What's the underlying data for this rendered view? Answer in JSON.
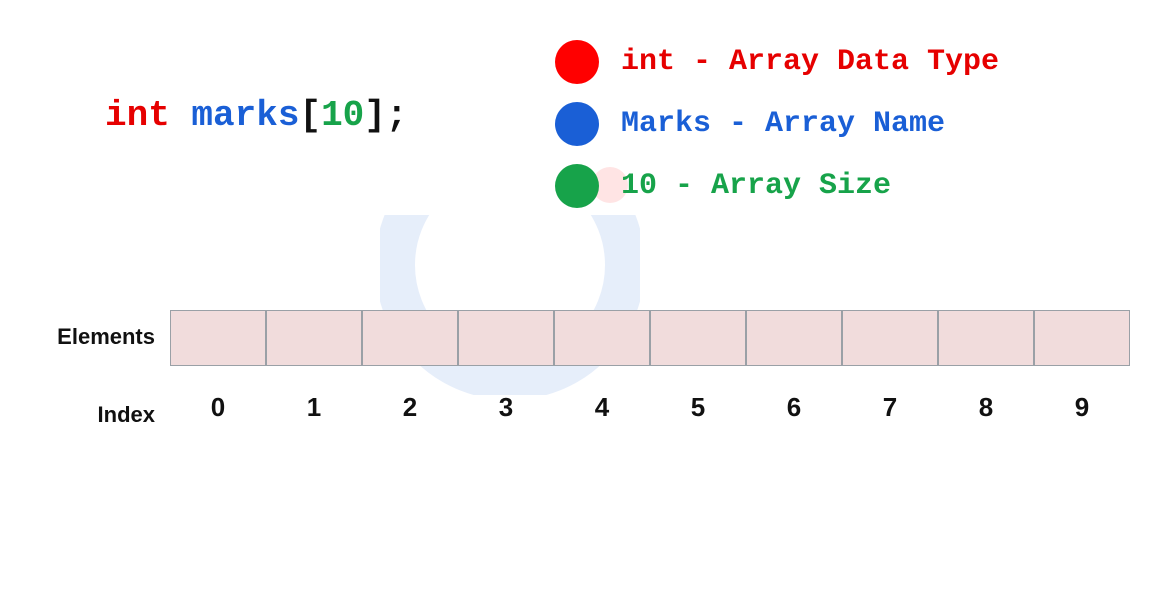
{
  "declaration": {
    "keyword": "int",
    "space1": " ",
    "name": "marks",
    "open_bracket": "[",
    "size": "10",
    "close_bracket": "]",
    "semicolon": ";"
  },
  "legend": {
    "items": [
      {
        "color": "red",
        "text": "int - Array Data Type"
      },
      {
        "color": "blue",
        "text": "Marks - Array Name"
      },
      {
        "color": "green",
        "text": "10 - Array Size"
      }
    ]
  },
  "array": {
    "elements_label": "Elements",
    "index_label": "Index",
    "size": 10,
    "indices": [
      "0",
      "1",
      "2",
      "3",
      "4",
      "5",
      "6",
      "7",
      "8",
      "9"
    ]
  },
  "colors": {
    "red": "#e60000",
    "blue": "#1a5fd6",
    "green": "#17a34a",
    "cell_fill": "#f1dcdc",
    "cell_border": "#9aa0a6"
  }
}
